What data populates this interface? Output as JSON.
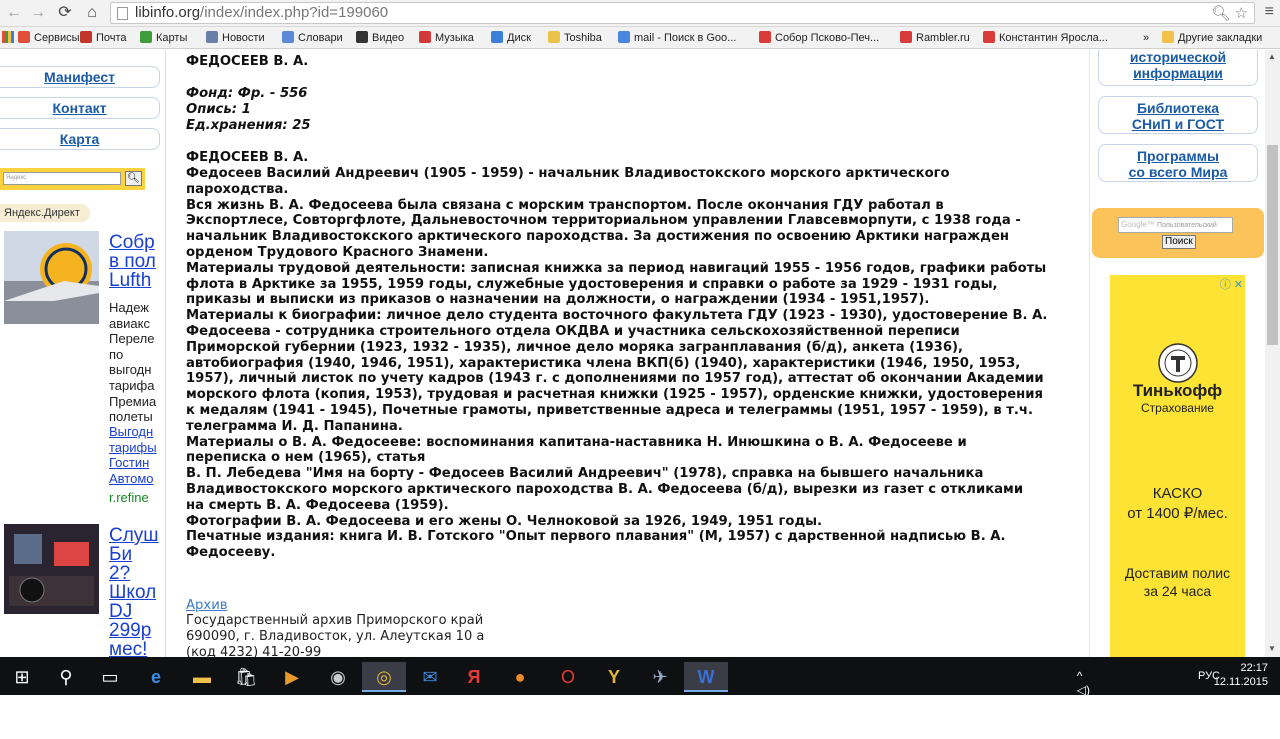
{
  "browser": {
    "url_domain": "libinfo.org",
    "url_path": "/index/index.php?id=199060",
    "bookmarks": [
      {
        "label": "Сервисы",
        "color": "#e14e3a"
      },
      {
        "label": "Почта",
        "color": "#c2352a"
      },
      {
        "label": "Карты",
        "color": "#3c9d3a"
      },
      {
        "label": "Новости",
        "color": "#6a7fa8"
      },
      {
        "label": "Словари",
        "color": "#5a8ad8"
      },
      {
        "label": "Видео",
        "color": "#333333"
      },
      {
        "label": "Музыка",
        "color": "#d23a3a"
      },
      {
        "label": "Диск",
        "color": "#3a7fd8"
      },
      {
        "label": "Toshiba",
        "color": "#e9c24a"
      },
      {
        "label": "mail - Поиск в Goo...",
        "color": "#4a87e0"
      },
      {
        "label": "Собор Псково-Печ...",
        "color": "#d93a3a"
      },
      {
        "label": "Rambler.ru",
        "color": "#d93a3a"
      },
      {
        "label": "Константин Яросла...",
        "color": "#d93a3a"
      }
    ],
    "bookmarks_more": "»",
    "other_bookmarks": "Другие закладки"
  },
  "left": {
    "nav": [
      "Манифест",
      "Контакт",
      "Карта"
    ],
    "search_placeholder": "Яндекс",
    "direct_label": "Яндекс.Директ",
    "ad1": {
      "title_lines": [
        "Собр",
        "в пол",
        "Lufth"
      ],
      "text_lines": [
        "Надеж",
        "авиакс",
        "Переле",
        "по",
        "выгодн",
        "тарифа",
        "Премиа",
        "полеты"
      ],
      "link_lines": [
        "Выгодн",
        "тарифы",
        "Гостин",
        "Автомо"
      ],
      "domain": "r.refine"
    },
    "ad2": {
      "title_lines": [
        "Слуш",
        "Би",
        "2?",
        "Школ",
        "DJ",
        "299р",
        "мес!"
      ]
    }
  },
  "main": {
    "heading": "ФЕДОСЕЕВ В. А.",
    "fond": "Фонд: Фр. - 556",
    "opis": "Опись: 1",
    "edhran": "Ед.хранения: 25",
    "heading2": "ФЕДОСЕЕВ В. А.",
    "body_lines": [
      "Федосеев Василий Андреевич (1905 - 1959) - начальник Владивостокского морского арктического",
      "пароходства.",
      "Вся жизнь В. А. Федосеева была связана с морским транспортом. После окончания ГДУ работал в",
      "Экспортлесе, Совторгфлоте, Дальневосточном территориальном управлении Главсевморпути, с 1938 года -",
      "начальник Владивостокского арктического пароходства. За достижения по освоению Арктики награжден",
      "орденом Трудового Красного Знамени.",
      "Материалы трудовой деятельности: записная книжка за период навигаций 1955 - 1956 годов, графики работы",
      "флота в Арктике за 1955, 1959 годы, служебные удостоверения и справки о работе за 1929 - 1931 годы,",
      "приказы и выписки из приказов о назначении на должности, о награждении (1934 - 1951,1957).",
      "Материалы к биографии: личное дело студента восточного факультета ГДУ (1923 - 1930), удостоверение В. А.",
      "Федосеева - сотрудника строительного отдела ОКДВА и участника сельскохозяйственной переписи",
      "Приморской губернии (1923, 1932 - 1935), личное дело моряка загранплавания (б/д), анкета (1936),",
      "автобиография (1940, 1946, 1951), характеристика члена ВКП(б) (1940), характеристики (1946, 1950, 1953,",
      "1957), личный листок по учету кадров (1943 г. с дополнениями по 1957 год), аттестат об окончании Академии",
      "морского флота (копия, 1953), трудовая и расчетная книжки (1925 - 1957), орденские книжки, удостоверения",
      "к медалям (1941 - 1945), Почетные грамоты, приветственные адреса и телеграммы (1951, 1957 - 1959), в т.ч.",
      "телеграмма И. Д. Папанина.",
      "Материалы о В. А. Федосееве: воспоминания капитана-наставника Н. Инюшкина о В. А. Федосееве и",
      "переписка о нем (1965), статья",
      "В. П. Лебедева \"Имя на борту - Федосеев Василий Андреевич\" (1978), справка на бывшего начальника",
      "Владивостокского морского арктического пароходства В. А. Федосеева (б/д), вырезки из газет с откликами",
      "на смерть В. А. Федосеева (1959).",
      "Фотографии В. А. Федосеева и его жены О. Челноковой за 1926, 1949, 1951 годы.",
      "Печатные издания: книга И. В. Готского \"Опыт первого плавания\" (М, 1957) с дарственной надписью В. А.",
      "Федосееву."
    ],
    "archive_link": "Архив",
    "archive_lines": [
      "Государственный архив Приморского край",
      "690090, г. Владивосток, ул. Алеутская 10 а",
      "(код 4232) 41-20-99"
    ]
  },
  "right": {
    "buttons": [
      [
        "исторической",
        "информации"
      ],
      [
        "Библиотека",
        "СНиП и ГОСТ"
      ],
      [
        "Программы",
        "со всего Мира"
      ]
    ],
    "search_placeholder": "Пользовательский",
    "search_button": "Поиск",
    "ad": {
      "brand": "Тинькофф",
      "sub": "Страхование",
      "line1": "КАСКО",
      "line2": "от 1400 ₽/мес.",
      "line3": "Доставим полис",
      "line4": "за 24 часа"
    }
  },
  "taskbar": {
    "lang": "РУС",
    "time": "22:17",
    "date": "12.11.2015"
  }
}
